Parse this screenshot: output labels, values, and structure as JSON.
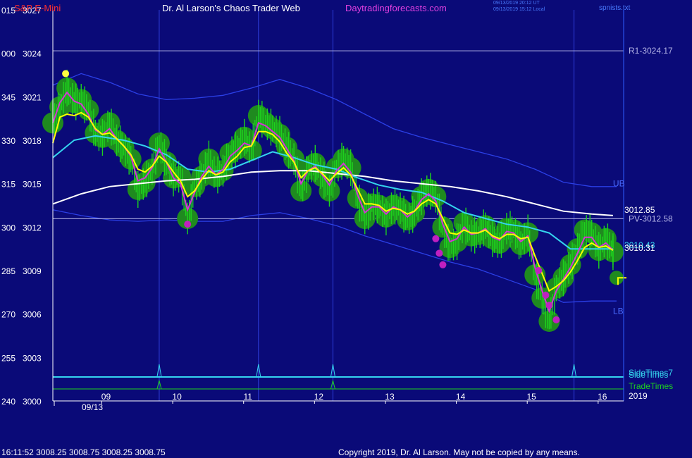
{
  "header": {
    "symbol": "S&P E-Mini",
    "site_title": "Dr. Al Larson's Chaos Trader Web",
    "site_url": "Daytradingforecasts.com",
    "ut_stamp": "09/13/2019 20:12 UT",
    "local_stamp": "09/13/2019 15:12 Local",
    "file_name": "spnists.txt"
  },
  "footer": {
    "quote": "16:11:52  3008.25 3008.75 3008.25 3008.75",
    "copyright": "Copyright 2019, Dr. Al Larson. May not be copied by any means."
  },
  "colors": {
    "background": "#0a0a78",
    "price": "#1ed21e",
    "bubble": "#1f8a1f",
    "yellow_ma": "#ffff00",
    "magenta_ma": "#d633d6",
    "cyan_ma": "#35d4ee",
    "white_ma": "#ffffff",
    "band": "#2b3fe6",
    "level_line": "#b4b4e6",
    "time_marker": "#2f3fdc"
  },
  "chart_data": {
    "type": "line",
    "ylim": [
      3000,
      3027
    ],
    "y_ticks": [
      {
        "left": "015",
        "right": "3027",
        "value": 3027
      },
      {
        "left": "000",
        "right": "3024",
        "value": 3024
      },
      {
        "left": "345",
        "right": "3021",
        "value": 3021
      },
      {
        "left": "330",
        "right": "3018",
        "value": 3018
      },
      {
        "left": "315",
        "right": "3015",
        "value": 3015
      },
      {
        "left": "300",
        "right": "3012",
        "value": 3012
      },
      {
        "left": "285",
        "right": "3009",
        "value": 3009
      },
      {
        "left": "270",
        "right": "3006",
        "value": 3006
      },
      {
        "left": "255",
        "right": "3003",
        "value": 3003
      },
      {
        "left": "240",
        "right": "3000",
        "value": 3000
      }
    ],
    "xlim": [
      8.0,
      16.05
    ],
    "x_ticks": [
      {
        "label": "09",
        "value": 8.75
      },
      {
        "label": "10",
        "value": 9.75
      },
      {
        "label": "11",
        "value": 10.75
      },
      {
        "label": "12",
        "value": 11.75
      },
      {
        "label": "13",
        "value": 12.75
      },
      {
        "label": "14",
        "value": 13.75
      },
      {
        "label": "15",
        "value": 14.75
      },
      {
        "label": "16",
        "value": 15.75
      }
    ],
    "date_label": "09/13",
    "year_label": "2019",
    "hour_markers": [
      9.5,
      10.9,
      11.95,
      15.35
    ],
    "levels": [
      {
        "name": "R1",
        "label": "R1-3024.17",
        "value": 3024.17
      },
      {
        "name": "PV",
        "label": "PV-3012.58",
        "value": 3012.58
      }
    ],
    "band_labels": [
      {
        "label": "UB",
        "x": 15.9,
        "y": 3015
      },
      {
        "label": "LB",
        "x": 15.9,
        "y": 3006.2
      }
    ],
    "last_value_labels": [
      {
        "label": "3012.85",
        "value": 3012.85
      },
      {
        "label": "3010.43",
        "value": 3010.43
      },
      {
        "label": "3010.31",
        "value": 3010.31
      }
    ],
    "price_series": [
      [
        8.0,
        3019.2
      ],
      [
        8.1,
        3020.3
      ],
      [
        8.2,
        3021.6
      ],
      [
        8.3,
        3020.6
      ],
      [
        8.4,
        3020.8
      ],
      [
        8.5,
        3020.1
      ],
      [
        8.6,
        3018.5
      ],
      [
        8.7,
        3018.2
      ],
      [
        8.8,
        3019.2
      ],
      [
        8.9,
        3018.0
      ],
      [
        9.0,
        3017.5
      ],
      [
        9.1,
        3016.7
      ],
      [
        9.2,
        3014.6
      ],
      [
        9.3,
        3015.1
      ],
      [
        9.4,
        3016.0
      ],
      [
        9.5,
        3017.8
      ],
      [
        9.6,
        3016.5
      ],
      [
        9.7,
        3015.4
      ],
      [
        9.8,
        3015.5
      ],
      [
        9.9,
        3012.6
      ],
      [
        10.0,
        3014.8
      ],
      [
        10.1,
        3015.5
      ],
      [
        10.2,
        3016.7
      ],
      [
        10.3,
        3015.5
      ],
      [
        10.4,
        3015.9
      ],
      [
        10.5,
        3017.1
      ],
      [
        10.6,
        3017.4
      ],
      [
        10.7,
        3018.2
      ],
      [
        10.8,
        3017.3
      ],
      [
        10.9,
        3019.7
      ],
      [
        11.0,
        3019.2
      ],
      [
        11.1,
        3018.8
      ],
      [
        11.2,
        3018.4
      ],
      [
        11.3,
        3017.5
      ],
      [
        11.4,
        3016.7
      ],
      [
        11.5,
        3014.5
      ],
      [
        11.6,
        3016.0
      ],
      [
        11.7,
        3016.4
      ],
      [
        11.8,
        3015.5
      ],
      [
        11.9,
        3014.5
      ],
      [
        12.0,
        3016.1
      ],
      [
        12.1,
        3016.7
      ],
      [
        12.2,
        3016.1
      ],
      [
        12.3,
        3014.0
      ],
      [
        12.4,
        3012.6
      ],
      [
        12.5,
        3013.6
      ],
      [
        12.6,
        3013.5
      ],
      [
        12.7,
        3012.7
      ],
      [
        12.8,
        3013.5
      ],
      [
        12.9,
        3013.3
      ],
      [
        13.0,
        3012.5
      ],
      [
        13.1,
        3013.0
      ],
      [
        13.2,
        3014.1
      ],
      [
        13.3,
        3014.6
      ],
      [
        13.4,
        3014.1
      ],
      [
        13.5,
        3012.0
      ],
      [
        13.6,
        3010.6
      ],
      [
        13.7,
        3011.0
      ],
      [
        13.8,
        3012.3
      ],
      [
        13.9,
        3011.4
      ],
      [
        14.0,
        3011.5
      ],
      [
        14.1,
        3012.1
      ],
      [
        14.2,
        3011.2
      ],
      [
        14.3,
        3010.9
      ],
      [
        14.4,
        3011.9
      ],
      [
        14.5,
        3011.8
      ],
      [
        14.6,
        3010.8
      ],
      [
        14.7,
        3011.6
      ],
      [
        14.8,
        3008.7
      ],
      [
        14.9,
        3007.1
      ],
      [
        15.0,
        3005.5
      ],
      [
        15.1,
        3007.8
      ],
      [
        15.2,
        3008.5
      ],
      [
        15.3,
        3009.4
      ],
      [
        15.4,
        3010.5
      ],
      [
        15.5,
        3011.8
      ],
      [
        15.6,
        3011.6
      ],
      [
        15.7,
        3010.4
      ],
      [
        15.8,
        3011.2
      ],
      [
        15.9,
        3010.3
      ]
    ],
    "magenta_series": [
      [
        8.0,
        3019.2
      ],
      [
        8.1,
        3020.6
      ],
      [
        8.2,
        3021.3
      ],
      [
        8.3,
        3020.7
      ],
      [
        8.4,
        3020.5
      ],
      [
        8.5,
        3019.8
      ],
      [
        8.6,
        3018.7
      ],
      [
        8.7,
        3018.4
      ],
      [
        8.8,
        3018.8
      ],
      [
        8.9,
        3018.1
      ],
      [
        9.0,
        3017.6
      ],
      [
        9.1,
        3016.9
      ],
      [
        9.2,
        3015.2
      ],
      [
        9.3,
        3015.4
      ],
      [
        9.4,
        3016.1
      ],
      [
        9.5,
        3017.4
      ],
      [
        9.6,
        3016.5
      ],
      [
        9.7,
        3015.4
      ],
      [
        9.8,
        3015.0
      ],
      [
        9.9,
        3013.2
      ],
      [
        10.0,
        3014.4
      ],
      [
        10.1,
        3015.5
      ],
      [
        10.2,
        3016.2
      ],
      [
        10.3,
        3015.6
      ],
      [
        10.4,
        3016.0
      ],
      [
        10.5,
        3016.9
      ],
      [
        10.6,
        3017.3
      ],
      [
        10.7,
        3017.8
      ],
      [
        10.8,
        3017.6
      ],
      [
        10.9,
        3019.2
      ],
      [
        11.0,
        3019.0
      ],
      [
        11.1,
        3018.6
      ],
      [
        11.2,
        3018.2
      ],
      [
        11.3,
        3017.4
      ],
      [
        11.4,
        3016.6
      ],
      [
        11.5,
        3015.0
      ],
      [
        11.6,
        3015.9
      ],
      [
        11.7,
        3016.2
      ],
      [
        11.8,
        3015.6
      ],
      [
        11.9,
        3014.9
      ],
      [
        12.0,
        3015.9
      ],
      [
        12.1,
        3016.4
      ],
      [
        12.2,
        3015.8
      ],
      [
        12.3,
        3014.2
      ],
      [
        12.4,
        3013.0
      ],
      [
        12.5,
        3013.4
      ],
      [
        12.6,
        3013.4
      ],
      [
        12.7,
        3012.9
      ],
      [
        12.8,
        3013.4
      ],
      [
        12.9,
        3013.2
      ],
      [
        13.0,
        3012.7
      ],
      [
        13.1,
        3013.1
      ],
      [
        13.2,
        3013.9
      ],
      [
        13.3,
        3014.3
      ],
      [
        13.4,
        3013.8
      ],
      [
        13.5,
        3012.2
      ],
      [
        13.6,
        3011.0
      ],
      [
        13.7,
        3011.2
      ],
      [
        13.8,
        3012.0
      ],
      [
        13.9,
        3011.5
      ],
      [
        14.0,
        3011.6
      ],
      [
        14.1,
        3011.9
      ],
      [
        14.2,
        3011.3
      ],
      [
        14.3,
        3011.1
      ],
      [
        14.4,
        3011.7
      ],
      [
        14.5,
        3011.6
      ],
      [
        14.6,
        3011.0
      ],
      [
        14.7,
        3011.4
      ],
      [
        14.8,
        3009.2
      ],
      [
        14.9,
        3007.6
      ],
      [
        15.0,
        3006.2
      ],
      [
        15.1,
        3007.6
      ],
      [
        15.2,
        3008.4
      ],
      [
        15.3,
        3009.2
      ],
      [
        15.4,
        3010.2
      ],
      [
        15.5,
        3011.3
      ],
      [
        15.6,
        3011.3
      ],
      [
        15.7,
        3010.6
      ],
      [
        15.8,
        3010.9
      ],
      [
        15.9,
        3010.4
      ]
    ],
    "yellow_series": [
      [
        8.0,
        3017.8
      ],
      [
        8.1,
        3019.6
      ],
      [
        8.2,
        3019.8
      ],
      [
        8.3,
        3019.7
      ],
      [
        8.4,
        3019.9
      ],
      [
        8.5,
        3019.6
      ],
      [
        8.6,
        3018.8
      ],
      [
        8.7,
        3018.4
      ],
      [
        8.8,
        3018.5
      ],
      [
        8.9,
        3018.1
      ],
      [
        9.0,
        3017.6
      ],
      [
        9.1,
        3017.0
      ],
      [
        9.2,
        3016.0
      ],
      [
        9.3,
        3015.8
      ],
      [
        9.4,
        3016.2
      ],
      [
        9.5,
        3016.9
      ],
      [
        9.6,
        3016.5
      ],
      [
        9.7,
        3015.8
      ],
      [
        9.8,
        3015.2
      ],
      [
        9.9,
        3014.1
      ],
      [
        10.0,
        3014.5
      ],
      [
        10.1,
        3015.3
      ],
      [
        10.2,
        3015.9
      ],
      [
        10.3,
        3015.6
      ],
      [
        10.4,
        3015.8
      ],
      [
        10.5,
        3016.5
      ],
      [
        10.6,
        3016.9
      ],
      [
        10.7,
        3017.5
      ],
      [
        10.8,
        3017.6
      ],
      [
        10.9,
        3018.6
      ],
      [
        11.0,
        3018.6
      ],
      [
        11.1,
        3018.4
      ],
      [
        11.2,
        3017.9
      ],
      [
        11.3,
        3017.1
      ],
      [
        11.4,
        3016.5
      ],
      [
        11.5,
        3015.4
      ],
      [
        11.6,
        3015.9
      ],
      [
        11.7,
        3016.1
      ],
      [
        11.8,
        3015.7
      ],
      [
        11.9,
        3015.2
      ],
      [
        12.0,
        3015.7
      ],
      [
        12.1,
        3016.1
      ],
      [
        12.2,
        3015.6
      ],
      [
        12.3,
        3014.6
      ],
      [
        12.4,
        3013.6
      ],
      [
        12.5,
        3013.6
      ],
      [
        12.6,
        3013.5
      ],
      [
        12.7,
        3013.1
      ],
      [
        12.8,
        3013.3
      ],
      [
        12.9,
        3013.2
      ],
      [
        13.0,
        3012.9
      ],
      [
        13.1,
        3013.1
      ],
      [
        13.2,
        3013.6
      ],
      [
        13.3,
        3013.9
      ],
      [
        13.4,
        3013.6
      ],
      [
        13.5,
        3012.6
      ],
      [
        13.6,
        3011.6
      ],
      [
        13.7,
        3011.5
      ],
      [
        13.8,
        3011.8
      ],
      [
        13.9,
        3011.6
      ],
      [
        14.0,
        3011.6
      ],
      [
        14.1,
        3011.8
      ],
      [
        14.2,
        3011.4
      ],
      [
        14.3,
        3011.2
      ],
      [
        14.4,
        3011.5
      ],
      [
        14.5,
        3011.5
      ],
      [
        14.6,
        3011.2
      ],
      [
        14.7,
        3011.3
      ],
      [
        14.8,
        3010.0
      ],
      [
        14.9,
        3008.8
      ],
      [
        15.0,
        3007.6
      ],
      [
        15.1,
        3007.9
      ],
      [
        15.2,
        3008.3
      ],
      [
        15.3,
        3008.9
      ],
      [
        15.4,
        3009.7
      ],
      [
        15.5,
        3010.6
      ],
      [
        15.6,
        3010.9
      ],
      [
        15.7,
        3010.6
      ],
      [
        15.8,
        3010.7
      ],
      [
        15.9,
        3010.4
      ]
    ],
    "cyan_series": [
      [
        8.0,
        3016.8
      ],
      [
        8.3,
        3018.0
      ],
      [
        8.6,
        3018.3
      ],
      [
        9.0,
        3018.0
      ],
      [
        9.3,
        3017.6
      ],
      [
        9.6,
        3017.0
      ],
      [
        9.9,
        3016.0
      ],
      [
        10.2,
        3015.8
      ],
      [
        10.5,
        3016.0
      ],
      [
        10.8,
        3016.6
      ],
      [
        11.1,
        3017.2
      ],
      [
        11.4,
        3016.8
      ],
      [
        11.7,
        3016.3
      ],
      [
        12.0,
        3016.0
      ],
      [
        12.3,
        3015.4
      ],
      [
        12.6,
        3014.9
      ],
      [
        12.9,
        3014.6
      ],
      [
        13.2,
        3014.4
      ],
      [
        13.5,
        3013.8
      ],
      [
        13.8,
        3013.0
      ],
      [
        14.1,
        3012.6
      ],
      [
        14.4,
        3012.2
      ],
      [
        14.7,
        3012.0
      ],
      [
        15.0,
        3011.6
      ],
      [
        15.3,
        3010.5
      ],
      [
        15.6,
        3010.5
      ],
      [
        15.9,
        3010.5
      ]
    ],
    "white_series": [
      [
        8.0,
        3013.6
      ],
      [
        8.4,
        3014.3
      ],
      [
        8.8,
        3014.8
      ],
      [
        9.2,
        3015.0
      ],
      [
        9.6,
        3015.2
      ],
      [
        10.0,
        3015.3
      ],
      [
        10.4,
        3015.5
      ],
      [
        10.8,
        3015.8
      ],
      [
        11.2,
        3015.9
      ],
      [
        11.6,
        3015.9
      ],
      [
        12.0,
        3015.7
      ],
      [
        12.4,
        3015.5
      ],
      [
        12.8,
        3015.2
      ],
      [
        13.2,
        3015.0
      ],
      [
        13.6,
        3014.8
      ],
      [
        14.0,
        3014.5
      ],
      [
        14.4,
        3014.1
      ],
      [
        14.8,
        3013.6
      ],
      [
        15.2,
        3013.1
      ],
      [
        15.6,
        3012.9
      ],
      [
        15.9,
        3012.8
      ]
    ],
    "upper_band": [
      [
        8.0,
        3021.8
      ],
      [
        8.4,
        3022.6
      ],
      [
        8.8,
        3022.0
      ],
      [
        9.2,
        3021.2
      ],
      [
        9.6,
        3020.8
      ],
      [
        10.0,
        3020.9
      ],
      [
        10.4,
        3021.1
      ],
      [
        10.8,
        3021.6
      ],
      [
        11.2,
        3022.2
      ],
      [
        11.6,
        3021.6
      ],
      [
        12.0,
        3020.8
      ],
      [
        12.4,
        3019.8
      ],
      [
        12.8,
        3018.8
      ],
      [
        13.2,
        3018.2
      ],
      [
        13.6,
        3017.7
      ],
      [
        14.0,
        3017.2
      ],
      [
        14.4,
        3016.7
      ],
      [
        14.8,
        3016.0
      ],
      [
        15.2,
        3015.1
      ],
      [
        15.6,
        3014.8
      ],
      [
        15.95,
        3014.8
      ]
    ],
    "lower_band": [
      [
        8.0,
        3013.2
      ],
      [
        8.4,
        3012.8
      ],
      [
        8.8,
        3012.5
      ],
      [
        9.2,
        3012.4
      ],
      [
        9.6,
        3012.5
      ],
      [
        10.0,
        3012.4
      ],
      [
        10.4,
        3012.4
      ],
      [
        10.8,
        3012.8
      ],
      [
        11.2,
        3013.0
      ],
      [
        11.6,
        3012.6
      ],
      [
        12.0,
        3012.1
      ],
      [
        12.4,
        3011.4
      ],
      [
        12.8,
        3010.8
      ],
      [
        13.2,
        3010.2
      ],
      [
        13.6,
        3009.6
      ],
      [
        14.0,
        3009.1
      ],
      [
        14.4,
        3008.4
      ],
      [
        14.8,
        3007.7
      ],
      [
        15.2,
        3006.8
      ],
      [
        15.6,
        3006.9
      ],
      [
        15.95,
        3006.9
      ]
    ],
    "magenta_dots": [
      [
        9.9,
        3012.2
      ],
      [
        13.4,
        3011.2
      ],
      [
        13.45,
        3010.2
      ],
      [
        13.5,
        3009.4
      ],
      [
        14.85,
        3009.0
      ],
      [
        14.95,
        3007.3
      ],
      [
        15.0,
        3006.6
      ],
      [
        15.1,
        3005.6
      ]
    ],
    "yellow_dot": [
      8.18,
      3022.6
    ],
    "last_bubble": [
      15.95,
      3008.5
    ],
    "indicator_lines": [
      {
        "name": "SideTimes",
        "label": "SideTimes",
        "label2": "SideTimes7",
        "color": "#35d4ee",
        "spikes": [
          9.5,
          10.9,
          11.95,
          15.35
        ]
      },
      {
        "name": "TradeTimes",
        "label": "TradeTimes",
        "color": "#1ed21e",
        "spikes": [
          9.5,
          11.95
        ]
      }
    ]
  }
}
